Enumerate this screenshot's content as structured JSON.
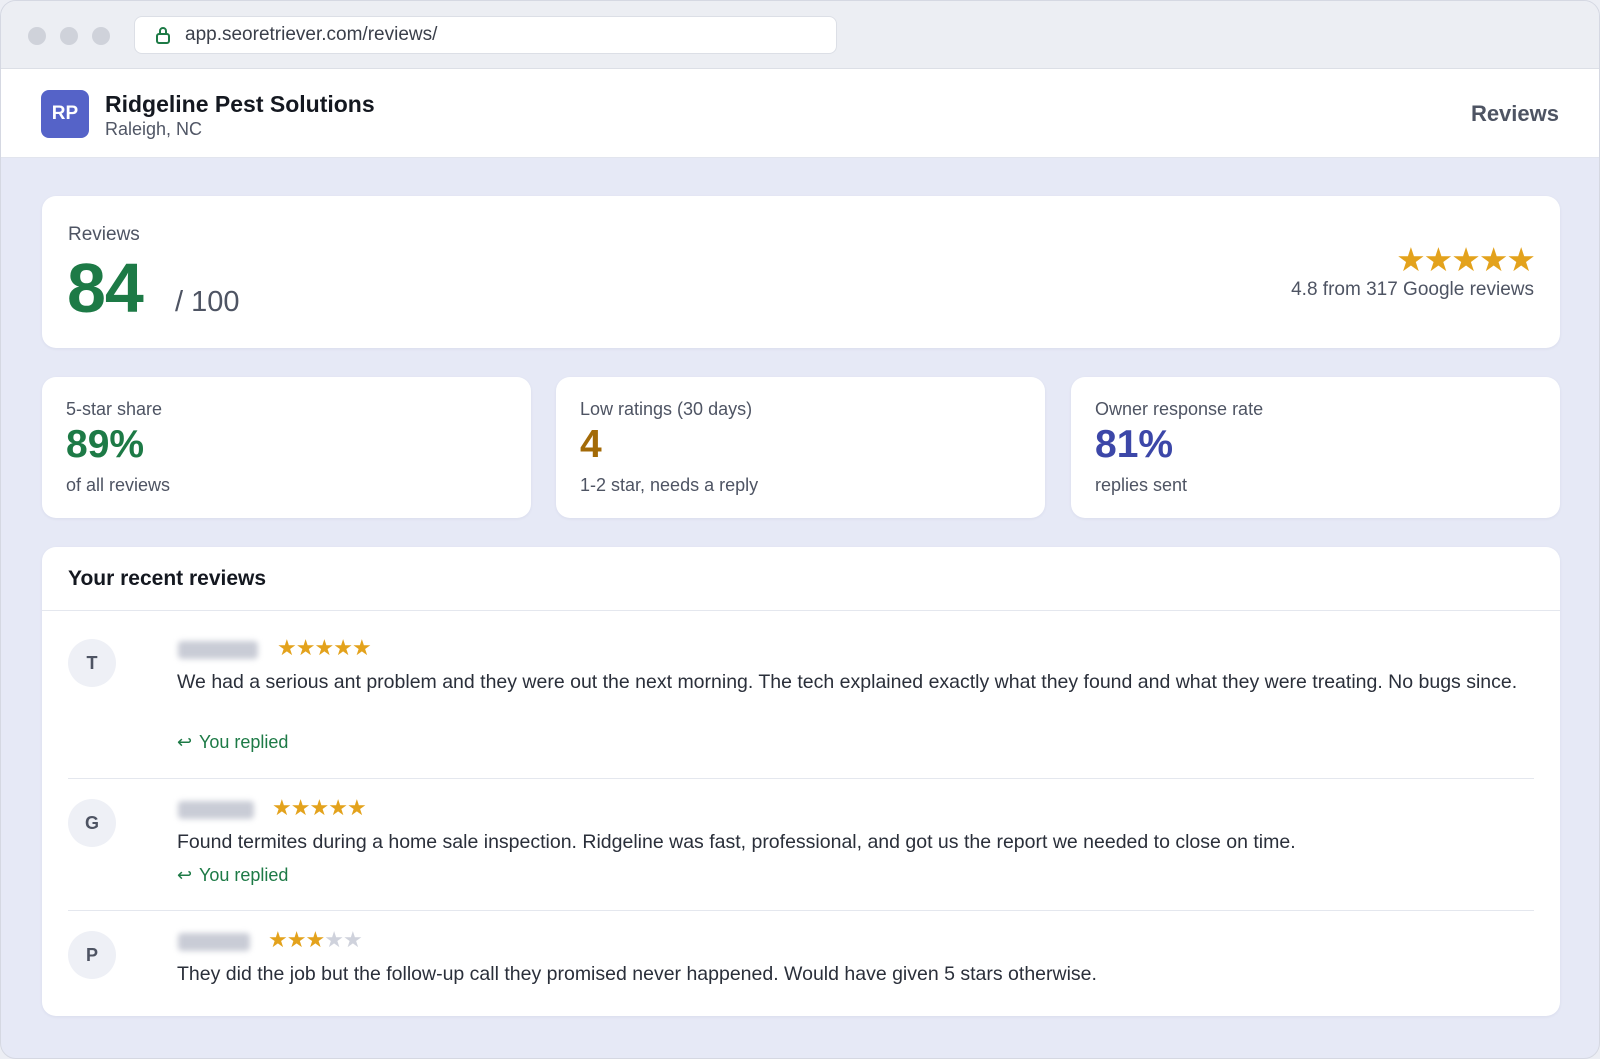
{
  "browser": {
    "url": "app.seoretriever.com/reviews/"
  },
  "header": {
    "logo_initials": "RP",
    "business_name": "Ridgeline Pest Solutions",
    "location": "Raleigh, NC",
    "nav_label": "Reviews"
  },
  "score": {
    "label": "Reviews",
    "value": "84",
    "max": "/ 100",
    "stars": "★★★★★",
    "rating_text": "4.8 from 317 Google reviews"
  },
  "stats": [
    {
      "label": "5-star share",
      "value": "89%",
      "sub": "of all reviews",
      "color": "#1d7a46"
    },
    {
      "label": "Low ratings (30 days)",
      "value": "4",
      "sub": "1-2 star, needs a reply",
      "color": "#a36a07"
    },
    {
      "label": "Owner response rate",
      "value": "81%",
      "sub": "replies sent",
      "color": "#3c47a8"
    }
  ],
  "recent": {
    "title": "Your recent reviews",
    "reviews": [
      {
        "initial": "T",
        "rating": 5,
        "text": "We had a serious ant problem and they were out the next morning. The tech explained exactly what they found and what they were treating. No bugs since.",
        "replied": "You replied"
      },
      {
        "initial": "G",
        "rating": 5,
        "text": "Found termites during a home sale inspection. Ridgeline was fast, professional, and got us the report we needed to close on time.",
        "replied": "You replied"
      },
      {
        "initial": "P",
        "rating": 3,
        "text": "They did the job but the follow-up call they promised never happened. Would have given 5 stars otherwise."
      }
    ]
  },
  "colors": {
    "accent_green": "#1d7a46",
    "star_gold": "#e3a21c",
    "logo_purple": "#5563c8"
  }
}
